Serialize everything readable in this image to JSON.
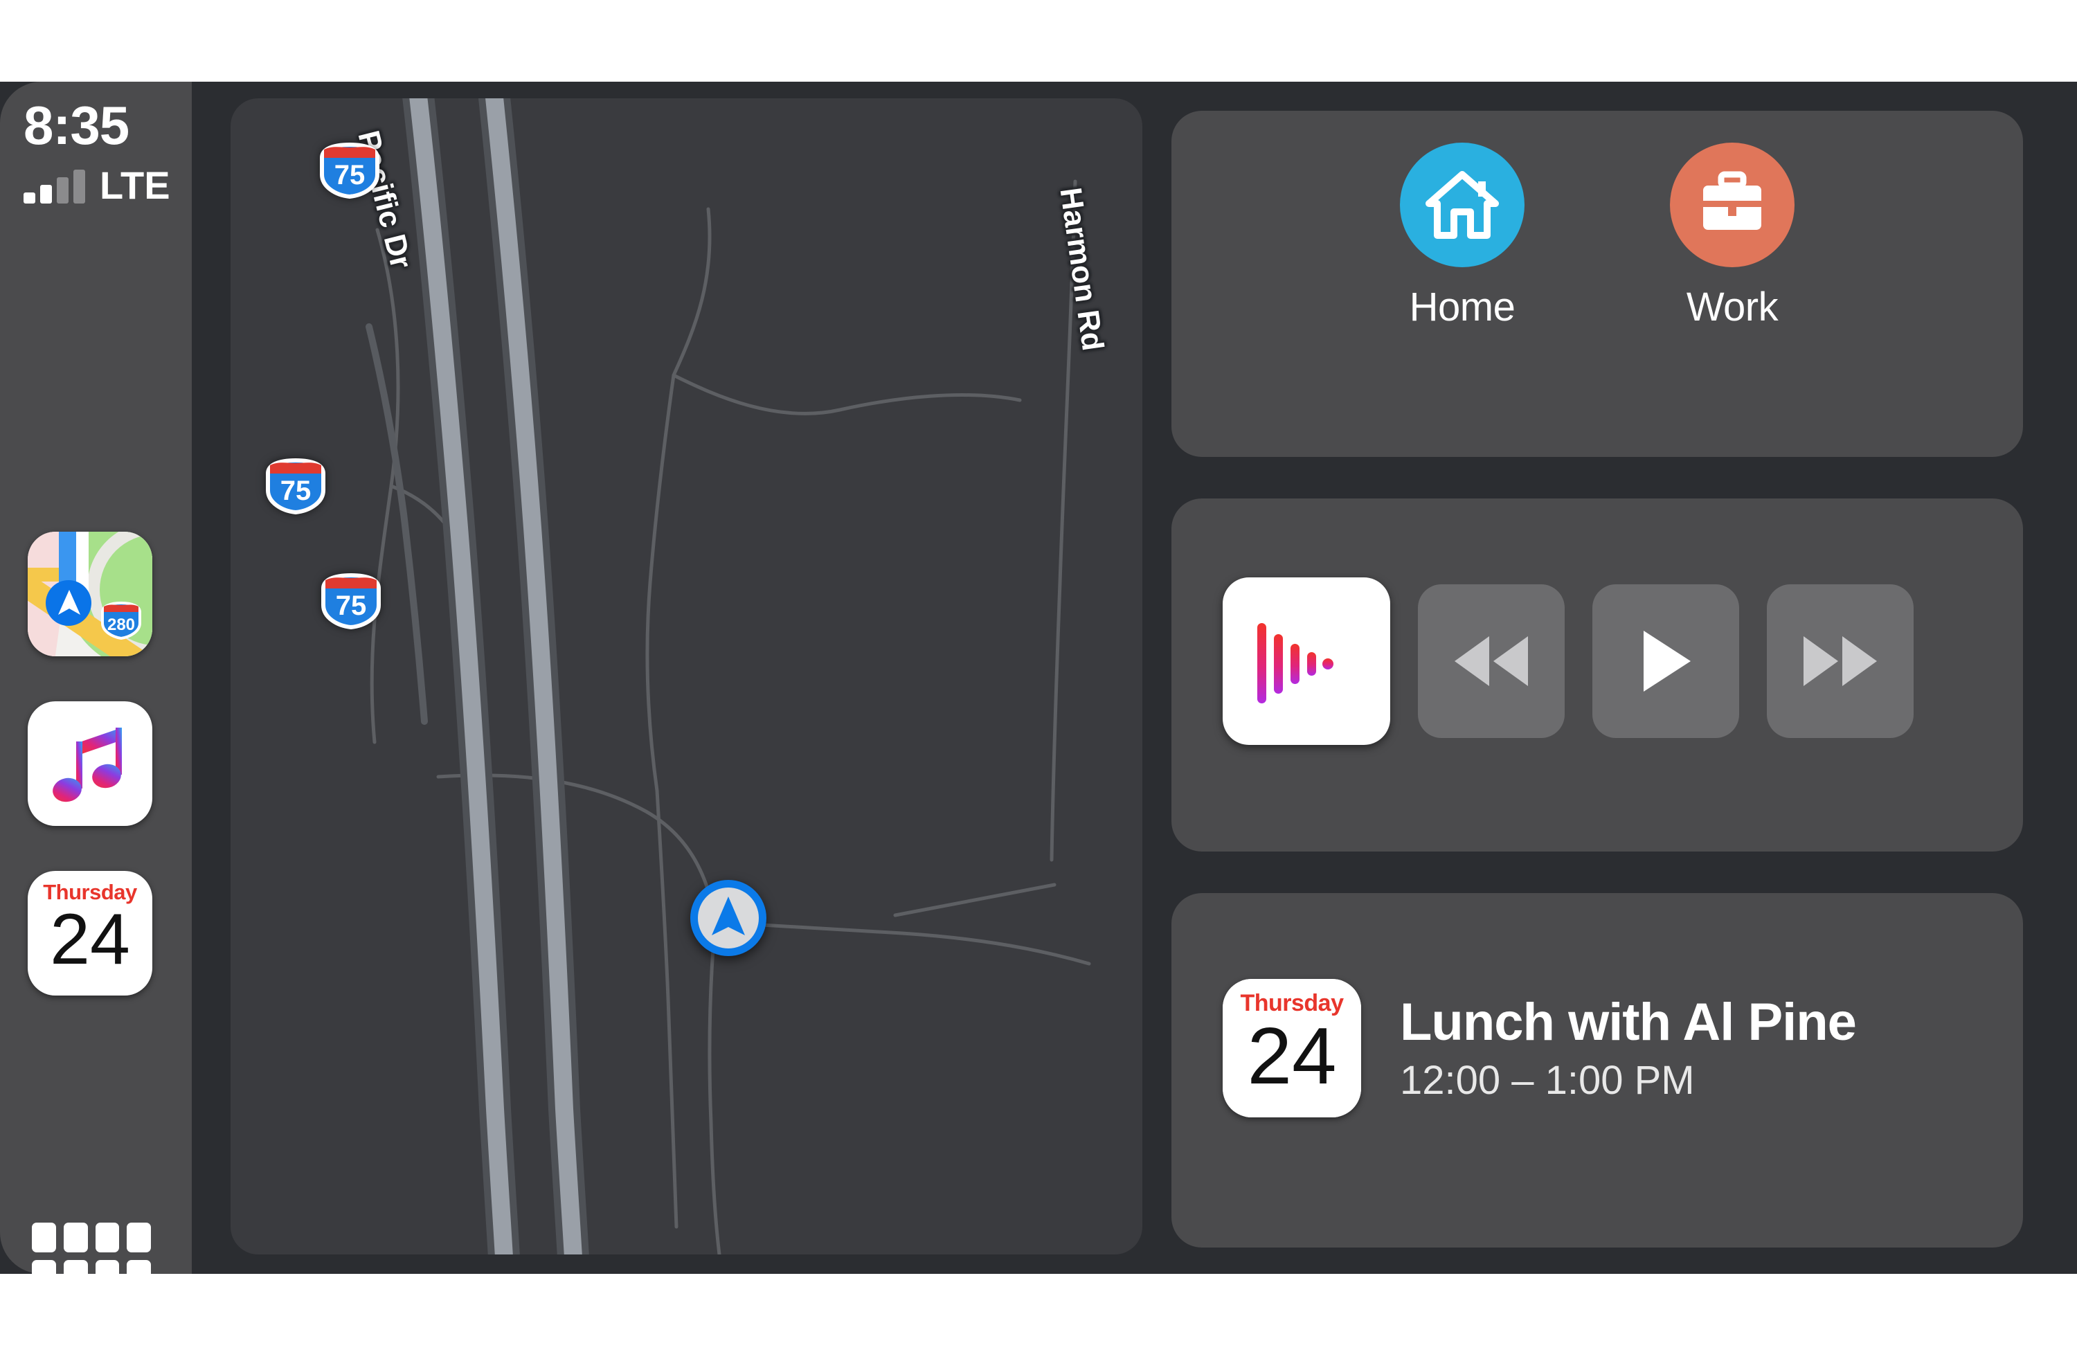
{
  "status_bar": {
    "time": "8:35",
    "carrier": "LTE",
    "signal_bars_total": 4,
    "signal_bars_filled": 2
  },
  "sidebar": {
    "apps": [
      {
        "name": "Maps",
        "icon": "maps-icon",
        "shield_number": "280"
      },
      {
        "name": "Music",
        "icon": "music-note-icon"
      },
      {
        "name": "Calendar",
        "icon": "calendar-icon",
        "weekday": "Thursday",
        "day": "24"
      }
    ],
    "app_grid": {
      "label": "All Apps",
      "icon": "app-grid-icon",
      "rows": 2,
      "cols": 4
    }
  },
  "map": {
    "road_labels": [
      {
        "name": "Pacific Dr"
      },
      {
        "name": "Harmon Rd"
      }
    ],
    "shields": [
      {
        "route": "75",
        "type": "interstate"
      },
      {
        "route": "75",
        "type": "interstate"
      },
      {
        "route": "75",
        "type": "interstate"
      }
    ],
    "location_puck": "current-location-icon"
  },
  "favorites": {
    "items": [
      {
        "label": "Home",
        "icon": "house-icon",
        "color": "#2ab0e0"
      },
      {
        "label": "Work",
        "icon": "briefcase-icon",
        "color": "#e0765a"
      }
    ]
  },
  "media": {
    "album_art_icon": "now-playing-waveform-icon",
    "controls": [
      {
        "label": "Rewind",
        "icon": "rewind-icon"
      },
      {
        "label": "Play",
        "icon": "play-icon"
      },
      {
        "label": "Fast Forward",
        "icon": "fast-forward-icon"
      }
    ]
  },
  "event": {
    "weekday": "Thursday",
    "day": "24",
    "title": "Lunch with Al Pine",
    "time": "12:00 – 1:00 PM"
  },
  "colors": {
    "background": "#2b2d31",
    "sidebar": "#4b4b4d",
    "card": "#4b4b4d",
    "map": "#3a3b3f",
    "accent_blue": "#0b7ae8",
    "home_blue": "#2ab0e0",
    "work_coral": "#e0765a",
    "calendar_red": "#e8352c"
  }
}
